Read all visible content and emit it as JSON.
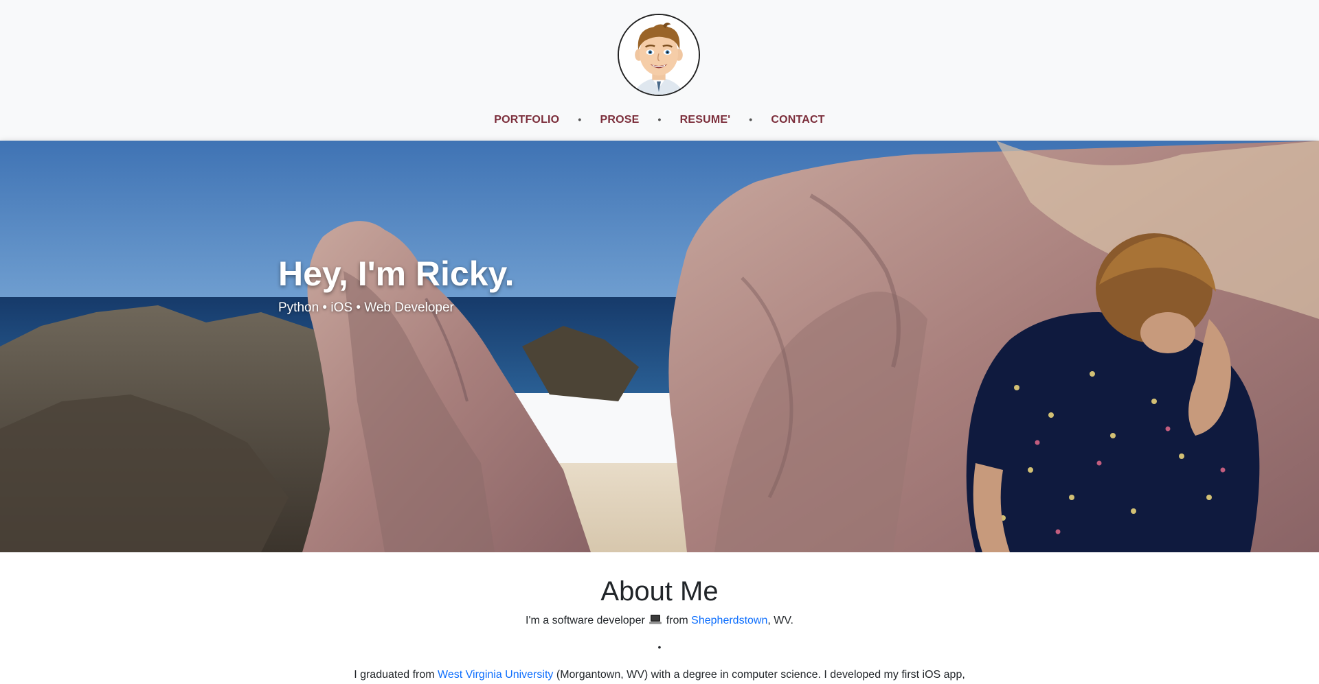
{
  "nav": {
    "items": [
      "PORTFOLIO",
      "PROSE",
      "RESUME'",
      "CONTACT"
    ],
    "separator": "•"
  },
  "hero": {
    "title": "Hey, I'm Ricky.",
    "subtitle": "Python • iOS • Web Developer"
  },
  "about": {
    "heading": "About Me",
    "line1_prefix": "I'm a software developer",
    "line1_icon": "laptop-icon",
    "line1_middle": "from",
    "hometown_link": "Shepherdstown",
    "line1_suffix": ", WV.",
    "divider": "•",
    "line2_prefix": "I graduated from",
    "university_link": "West Virginia University",
    "line2_suffix": "(Morgantown, WV) with a degree in computer science. I developed my first iOS app,"
  },
  "colors": {
    "nav_link": "#7b2d3a",
    "link_blue": "#0d6efd",
    "header_bg": "#f8f9fa"
  }
}
